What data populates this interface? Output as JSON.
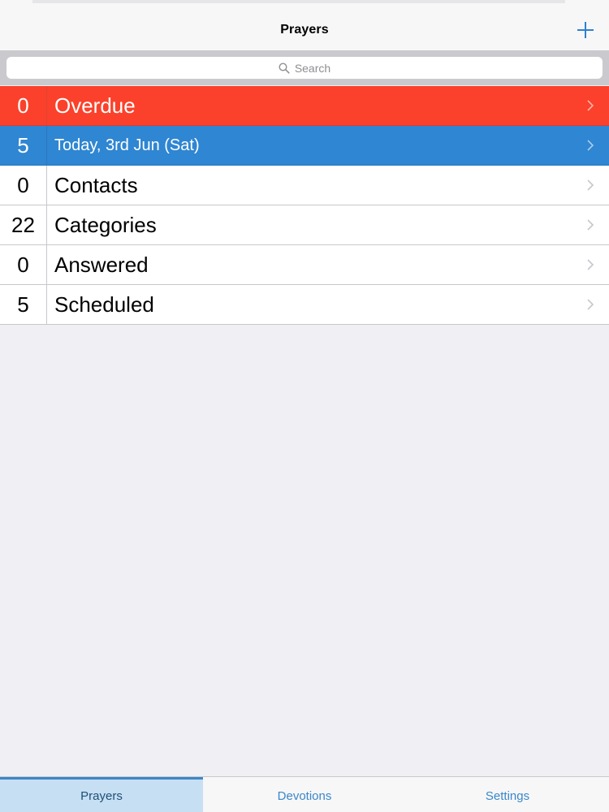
{
  "nav": {
    "title": "Prayers",
    "add_icon": "plus-icon"
  },
  "search": {
    "placeholder": "Search",
    "icon": "search-icon"
  },
  "colors": {
    "overdue": "#fb412b",
    "today": "#2f86d2",
    "accent": "#3a87c8"
  },
  "list": {
    "rows": [
      {
        "count": "0",
        "label": "Overdue"
      },
      {
        "count": "5",
        "label": "Today, 3rd Jun (Sat)"
      },
      {
        "count": "0",
        "label": "Contacts"
      },
      {
        "count": "22",
        "label": "Categories"
      },
      {
        "count": "0",
        "label": "Answered"
      },
      {
        "count": "5",
        "label": "Scheduled"
      }
    ]
  },
  "tabs": [
    {
      "label": "Prayers",
      "selected": true
    },
    {
      "label": "Devotions",
      "selected": false
    },
    {
      "label": "Settings",
      "selected": false
    }
  ]
}
